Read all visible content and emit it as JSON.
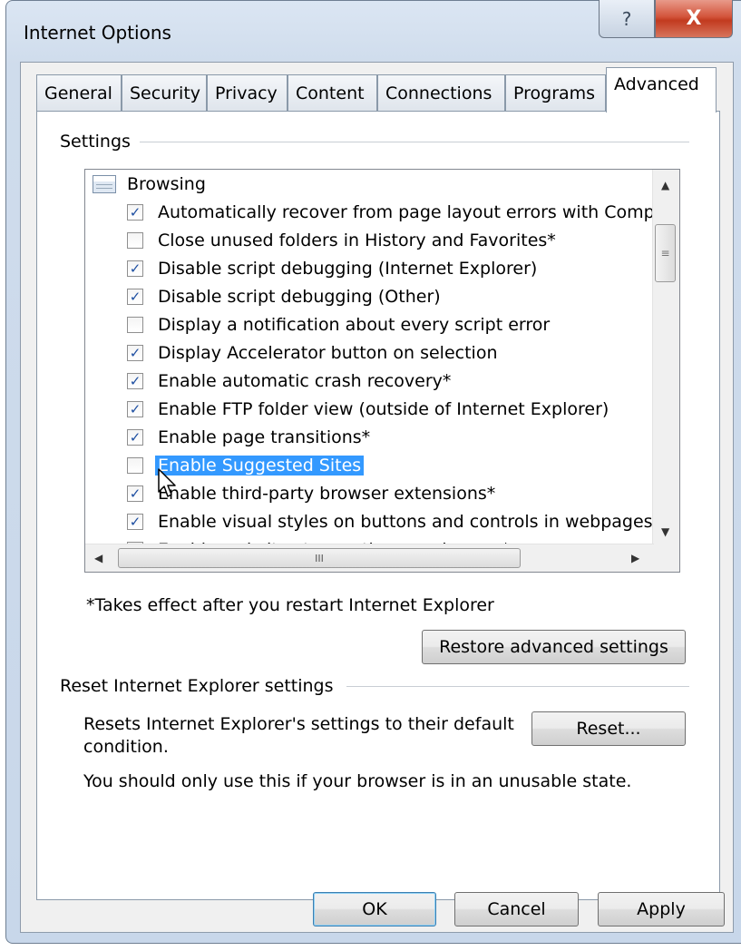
{
  "window": {
    "title": "Internet Options",
    "help_label": "?",
    "close_label": "X"
  },
  "tabs": [
    {
      "label": "General"
    },
    {
      "label": "Security"
    },
    {
      "label": "Privacy"
    },
    {
      "label": "Content"
    },
    {
      "label": "Connections"
    },
    {
      "label": "Programs"
    },
    {
      "label": "Advanced"
    }
  ],
  "active_tab": "Advanced",
  "settings": {
    "group_label": "Settings",
    "category": "Browsing",
    "items": [
      {
        "label": "Automatically recover from page layout errors with Compa",
        "checked": true
      },
      {
        "label": "Close unused folders in History and Favorites*",
        "checked": false
      },
      {
        "label": "Disable script debugging (Internet Explorer)",
        "checked": true
      },
      {
        "label": "Disable script debugging (Other)",
        "checked": true
      },
      {
        "label": "Display a notification about every script error",
        "checked": false
      },
      {
        "label": "Display Accelerator button on selection",
        "checked": true
      },
      {
        "label": "Enable automatic crash recovery*",
        "checked": true
      },
      {
        "label": "Enable FTP folder view (outside of Internet Explorer)",
        "checked": true
      },
      {
        "label": "Enable page transitions*",
        "checked": true
      },
      {
        "label": "Enable Suggested Sites",
        "checked": false,
        "selected": true
      },
      {
        "label": "Enable third-party browser extensions*",
        "checked": true
      },
      {
        "label": "Enable visual styles on buttons and controls in webpages",
        "checked": true
      },
      {
        "label": "Enable websites to use the search pane*",
        "checked": false
      }
    ],
    "note": "*Takes effect after you restart Internet Explorer",
    "restore_label": "Restore advanced settings"
  },
  "reset": {
    "group_label": "Reset Internet Explorer settings",
    "description_line1": "Resets Internet Explorer's settings to their default",
    "description_line2": "condition.",
    "warning": "You should only use this if your browser is in an unusable state.",
    "button_label": "Reset..."
  },
  "footer": {
    "ok_label": "OK",
    "cancel_label": "Cancel",
    "apply_label": "Apply"
  },
  "colors": {
    "selection": "#3399ff",
    "check": "#1d4ea1",
    "close_button": "#c23a1f"
  }
}
